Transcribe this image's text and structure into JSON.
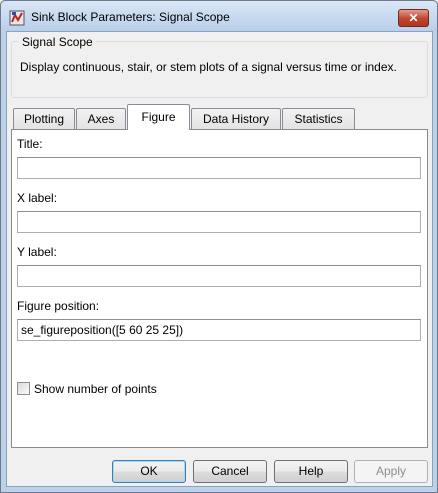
{
  "window": {
    "title": "Sink Block Parameters: Signal Scope",
    "close_symbol": "✕"
  },
  "group": {
    "legend": "Signal Scope",
    "description": "Display continuous, stair, or stem plots of a signal versus time or index."
  },
  "tabs": [
    {
      "label": "Plotting"
    },
    {
      "label": "Axes"
    },
    {
      "label": "Figure"
    },
    {
      "label": "Data History"
    },
    {
      "label": "Statistics"
    }
  ],
  "active_tab": "Figure",
  "fields": {
    "title_label": "Title:",
    "title_value": "",
    "xlabel_label": "X label:",
    "xlabel_value": "",
    "ylabel_label": "Y label:",
    "ylabel_value": "",
    "position_label": "Figure position:",
    "position_value": "se_figureposition([5 60 25 25])"
  },
  "checkbox": {
    "label": "Show number of points",
    "checked": false
  },
  "buttons": {
    "ok": "OK",
    "cancel": "Cancel",
    "help": "Help",
    "apply": "Apply"
  },
  "colors": {
    "close_button": "#c0432b",
    "default_button_border": "#3c7fb1"
  }
}
